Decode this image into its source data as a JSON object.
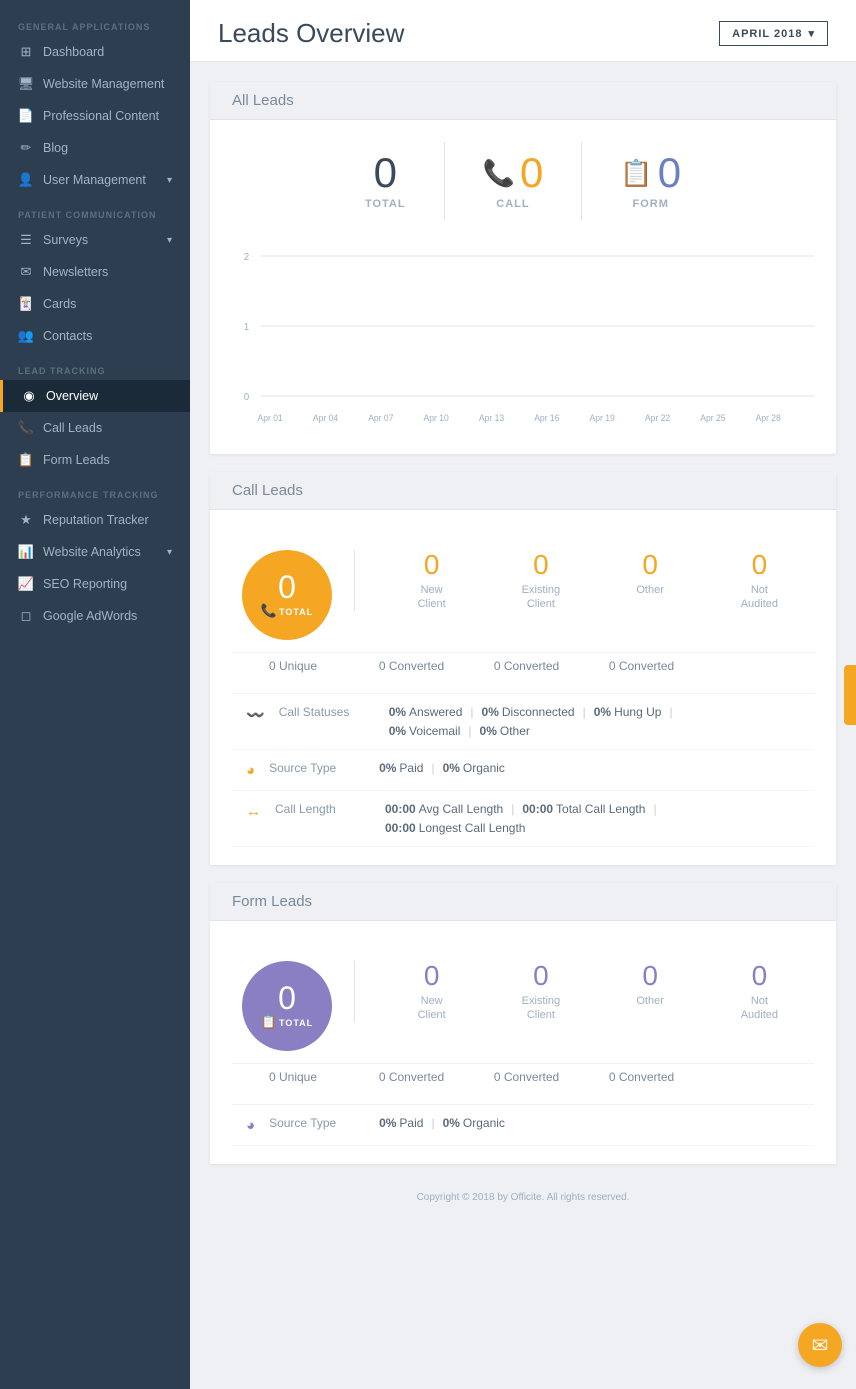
{
  "sidebar": {
    "sections": [
      {
        "title": "General Applications",
        "items": [
          {
            "id": "dashboard",
            "label": "Dashboard",
            "icon": "⊞",
            "active": false
          },
          {
            "id": "website-management",
            "label": "Website Management",
            "icon": "🖥",
            "active": false
          },
          {
            "id": "professional-content",
            "label": "Professional Content",
            "icon": "📄",
            "active": false
          },
          {
            "id": "blog",
            "label": "Blog",
            "icon": "✏",
            "active": false
          },
          {
            "id": "user-management",
            "label": "User Management",
            "icon": "👤",
            "active": false,
            "chevron": "▾"
          }
        ]
      },
      {
        "title": "Patient Communication",
        "items": [
          {
            "id": "surveys",
            "label": "Surveys",
            "icon": "☰",
            "active": false,
            "chevron": "▾"
          },
          {
            "id": "newsletters",
            "label": "Newsletters",
            "icon": "✉",
            "active": false
          },
          {
            "id": "cards",
            "label": "Cards",
            "icon": "🃏",
            "active": false
          },
          {
            "id": "contacts",
            "label": "Contacts",
            "icon": "👥",
            "active": false
          }
        ]
      },
      {
        "title": "Lead Tracking",
        "items": [
          {
            "id": "overview",
            "label": "Overview",
            "icon": "◉",
            "active": true
          },
          {
            "id": "call-leads",
            "label": "Call Leads",
            "icon": "📞",
            "active": false
          },
          {
            "id": "form-leads",
            "label": "Form Leads",
            "icon": "📋",
            "active": false
          }
        ]
      },
      {
        "title": "Performance Tracking",
        "items": [
          {
            "id": "reputation-tracker",
            "label": "Reputation Tracker",
            "icon": "★",
            "active": false
          },
          {
            "id": "website-analytics",
            "label": "Website Analytics",
            "icon": "📊",
            "active": false,
            "chevron": "▾"
          },
          {
            "id": "seo-reporting",
            "label": "SEO Reporting",
            "icon": "📈",
            "active": false
          },
          {
            "id": "google-adwords",
            "label": "Google AdWords",
            "icon": "◻",
            "active": false
          }
        ]
      }
    ]
  },
  "header": {
    "title": "Leads Overview",
    "date_label": "APRIL 2018",
    "date_chevron": "▾"
  },
  "all_leads": {
    "section_title": "All Leads",
    "stats": [
      {
        "label": "TOTAL",
        "value": "0",
        "color": "default"
      },
      {
        "label": "CALL",
        "value": "0",
        "color": "orange",
        "icon": "📞"
      },
      {
        "label": "FORM",
        "value": "0",
        "color": "purple",
        "icon": "📋"
      }
    ],
    "chart_x_labels": [
      "Apr 01",
      "Apr 04",
      "Apr 07",
      "Apr 10",
      "Apr 13",
      "Apr 16",
      "Apr 19",
      "Apr 22",
      "Apr 25",
      "Apr 28"
    ],
    "chart_y_labels": [
      "0",
      "1",
      "2"
    ]
  },
  "call_leads": {
    "section_title": "Call Leads",
    "circle": {
      "number": "0",
      "label": "TOTAL",
      "icon": "📞"
    },
    "breakdown": [
      {
        "label": "New\nClient",
        "value": "0"
      },
      {
        "label": "Existing\nClient",
        "value": "0"
      },
      {
        "label": "Other",
        "value": "0"
      },
      {
        "label": "Not\nAudited",
        "value": "0"
      }
    ],
    "unique_row": [
      {
        "label": "0 Unique"
      },
      {
        "label": "0 Converted"
      },
      {
        "label": "0 Converted"
      },
      {
        "label": "0 Converted"
      }
    ],
    "details": [
      {
        "id": "call-statuses",
        "icon": "〰",
        "label": "Call Statuses",
        "values": [
          {
            "pct": "0%",
            "text": "Answered"
          },
          {
            "sep": true
          },
          {
            "pct": "0%",
            "text": "Disconnected"
          },
          {
            "sep": true
          },
          {
            "pct": "0%",
            "text": "Hung Up"
          },
          {
            "sep": true
          },
          {
            "newline": true
          },
          {
            "pct": "0%",
            "text": "Voicemail"
          },
          {
            "sep": true
          },
          {
            "pct": "0%",
            "text": "Other"
          }
        ]
      },
      {
        "id": "source-type",
        "icon": "🥧",
        "label": "Source Type",
        "values": [
          {
            "pct": "0%",
            "text": "Paid"
          },
          {
            "sep": true
          },
          {
            "pct": "0%",
            "text": "Organic"
          }
        ]
      },
      {
        "id": "call-length",
        "icon": "↔",
        "label": "Call Length",
        "values": [
          {
            "pct": "00:00",
            "text": "Avg Call Length"
          },
          {
            "sep": true
          },
          {
            "pct": "00:00",
            "text": "Total Call Length"
          },
          {
            "sep": true
          },
          {
            "newline": true
          },
          {
            "pct": "00:00",
            "text": "Longest Call Length"
          }
        ]
      }
    ]
  },
  "form_leads": {
    "section_title": "Form Leads",
    "circle": {
      "number": "0",
      "label": "TOTAL",
      "icon": "📋"
    },
    "breakdown": [
      {
        "label": "New\nClient",
        "value": "0"
      },
      {
        "label": "Existing\nClient",
        "value": "0"
      },
      {
        "label": "Other",
        "value": "0"
      },
      {
        "label": "Not\nAudited",
        "value": "0"
      }
    ],
    "unique_row": [
      {
        "label": "0 Unique"
      },
      {
        "label": "0 Converted"
      },
      {
        "label": "0 Converted"
      },
      {
        "label": "0 Converted"
      }
    ],
    "details": [
      {
        "id": "source-type-form",
        "icon": "🥧",
        "label": "Source Type",
        "values": [
          {
            "pct": "0%",
            "text": "Paid"
          },
          {
            "sep": true
          },
          {
            "pct": "0%",
            "text": "Organic"
          }
        ]
      }
    ]
  },
  "footer": {
    "text": "Copyright © 2018 by Officite. All rights reserved."
  }
}
